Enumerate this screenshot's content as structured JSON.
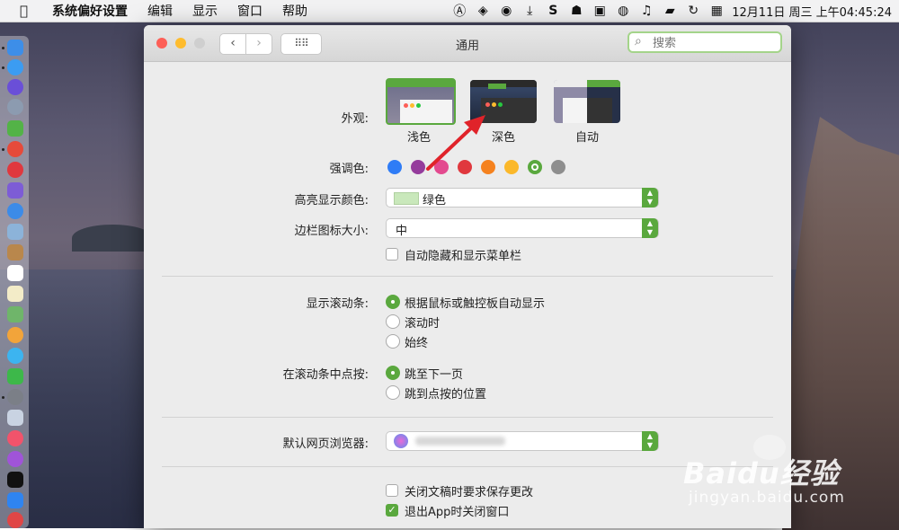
{
  "menubar": {
    "app_name": "系统偏好设置",
    "items": [
      "编辑",
      "显示",
      "窗口",
      "帮助"
    ],
    "clock": "12月11日 周三 上午04:45:24"
  },
  "window": {
    "title": "通用",
    "search_placeholder": "搜索"
  },
  "appearance": {
    "label": "外观:",
    "options": [
      "浅色",
      "深色",
      "自动"
    ],
    "selected": "浅色"
  },
  "accent": {
    "label": "强调色:",
    "colors": [
      "#2f7cf6",
      "#953c9c",
      "#e34a8f",
      "#e0383e",
      "#f5821f",
      "#fbb82a",
      "#5aa83e",
      "#8e8e8e"
    ],
    "selected_index": 6
  },
  "highlight": {
    "label": "高亮显示颜色:",
    "value": "绿色",
    "swatch": "#c9e8bb"
  },
  "sidebar_icon_size": {
    "label": "边栏图标大小:",
    "value": "中"
  },
  "menubar_autohide": {
    "label": "自动隐藏和显示菜单栏",
    "checked": false
  },
  "scrollbars": {
    "label": "显示滚动条:",
    "options": [
      "根据鼠标或触控板自动显示",
      "滚动时",
      "始终"
    ],
    "selected_index": 0
  },
  "scroll_click": {
    "label": "在滚动条中点按:",
    "options": [
      "跳至下一页",
      "跳到点按的位置"
    ],
    "selected_index": 0
  },
  "default_browser": {
    "label": "默认网页浏览器:"
  },
  "ask_save": {
    "label": "关闭文稿时要求保存更改",
    "checked": false
  },
  "close_windows": {
    "label": "退出App时关闭窗口",
    "checked": true
  },
  "watermark": {
    "brand": "Baidu经验",
    "url": "jingyan.baidu.com"
  }
}
